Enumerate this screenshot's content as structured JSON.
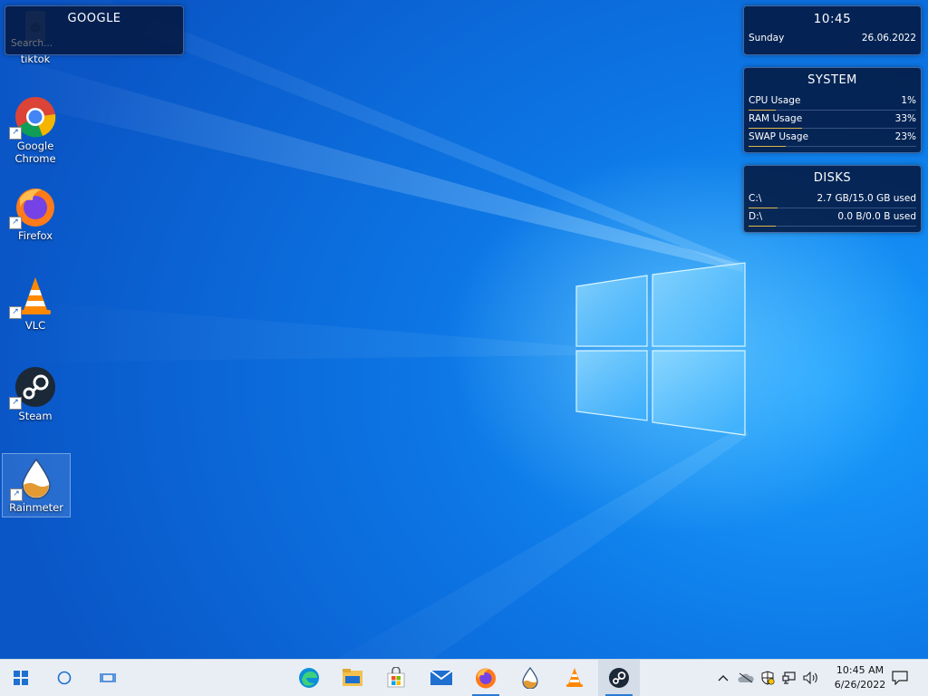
{
  "colors": {
    "widget_bg": "#04163c",
    "bar_accent": "#e0b94a",
    "taskbar_bg": "#e9eef5"
  },
  "google_widget": {
    "title": "GOOGLE",
    "placeholder": "Search..."
  },
  "clock_widget": {
    "time": "10:45",
    "day": "Sunday",
    "date": "26.06.2022"
  },
  "system_widget": {
    "title": "SYSTEM",
    "rows": [
      {
        "label": "CPU Usage",
        "value": "1%",
        "level": 0.01
      },
      {
        "label": "RAM Usage",
        "value": "33%",
        "level": 0.33
      },
      {
        "label": "SWAP Usage",
        "value": "23%",
        "level": 0.23
      }
    ]
  },
  "disks_widget": {
    "title": "DISKS",
    "rows": [
      {
        "label": "C:\\",
        "value": "2.7 GB/15.0 GB used",
        "level": 0.18
      },
      {
        "label": "D:\\",
        "value": "0.0 B/0.0 B used",
        "level": 0.0
      }
    ]
  },
  "desktop_icons": [
    {
      "label": "tiktok",
      "icon": "recycle-bin-icon"
    },
    {
      "label": "Google Chrome",
      "icon": "chrome-icon"
    },
    {
      "label": "Firefox",
      "icon": "firefox-icon"
    },
    {
      "label": "VLC",
      "icon": "vlc-icon"
    },
    {
      "label": "Steam",
      "icon": "steam-icon"
    },
    {
      "label": "Rainmeter",
      "icon": "rainmeter-icon"
    }
  ],
  "taskbar": {
    "start_icon": "windows-start-icon",
    "search_icon": "cortana-circle-icon",
    "taskview_icon": "task-view-icon",
    "pinned": [
      "edge-icon",
      "file-explorer-icon",
      "store-icon",
      "mail-icon",
      "firefox-icon",
      "rainmeter-icon",
      "vlc-icon",
      "steam-icon"
    ],
    "tray_icons": [
      "chevron-up-icon",
      "onedrive-icon",
      "security-icon",
      "network-icon",
      "volume-icon"
    ],
    "time": "10:45 AM",
    "date": "6/26/2022",
    "notification_icon": "notification-icon"
  }
}
